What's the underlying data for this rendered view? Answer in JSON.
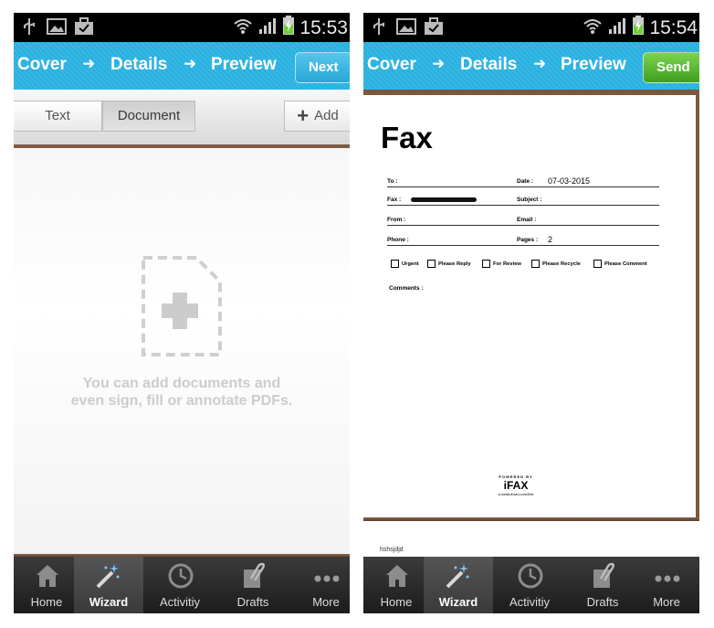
{
  "status_bar": {
    "left_time": "15:53",
    "right_time": "15:54"
  },
  "wizard_steps": [
    "Cover",
    "Details",
    "Preview"
  ],
  "left_screen": {
    "next_label": "Next",
    "segments": [
      "Text",
      "Document"
    ],
    "add_label": "Add",
    "empty_message_line1": "You can add documents and",
    "empty_message_line2": "even sign, fill or annotate PDFs."
  },
  "right_screen": {
    "send_label": "Send",
    "fax_title": "Fax",
    "fields": {
      "to": "To :",
      "date": "Date :",
      "date_value": "07-03-2015",
      "fax": "Fax :",
      "subject": "Subject :",
      "from": "From :",
      "email": "Email :",
      "phone": "Phone :",
      "pages": "Pages :",
      "pages_value": "2"
    },
    "checkboxes": [
      "Urgent",
      "Please Reply",
      "For Review",
      "Please Recycle",
      "Please Comment"
    ],
    "comments_label": "Comments :",
    "powered_by": "POWERED BY",
    "brand": "iFAX",
    "brand_url": "crowdedroad.com/ifax",
    "note_text": "hshsjdjd"
  },
  "tabs": [
    "Home",
    "Wizard",
    "Activitiy",
    "Drafts",
    "More"
  ],
  "colors": {
    "wizard_bar": "#2bb0de",
    "next_button": "#37b4e2",
    "send_button": "#4caf2a",
    "tab_bar": "#2a2a2a"
  }
}
